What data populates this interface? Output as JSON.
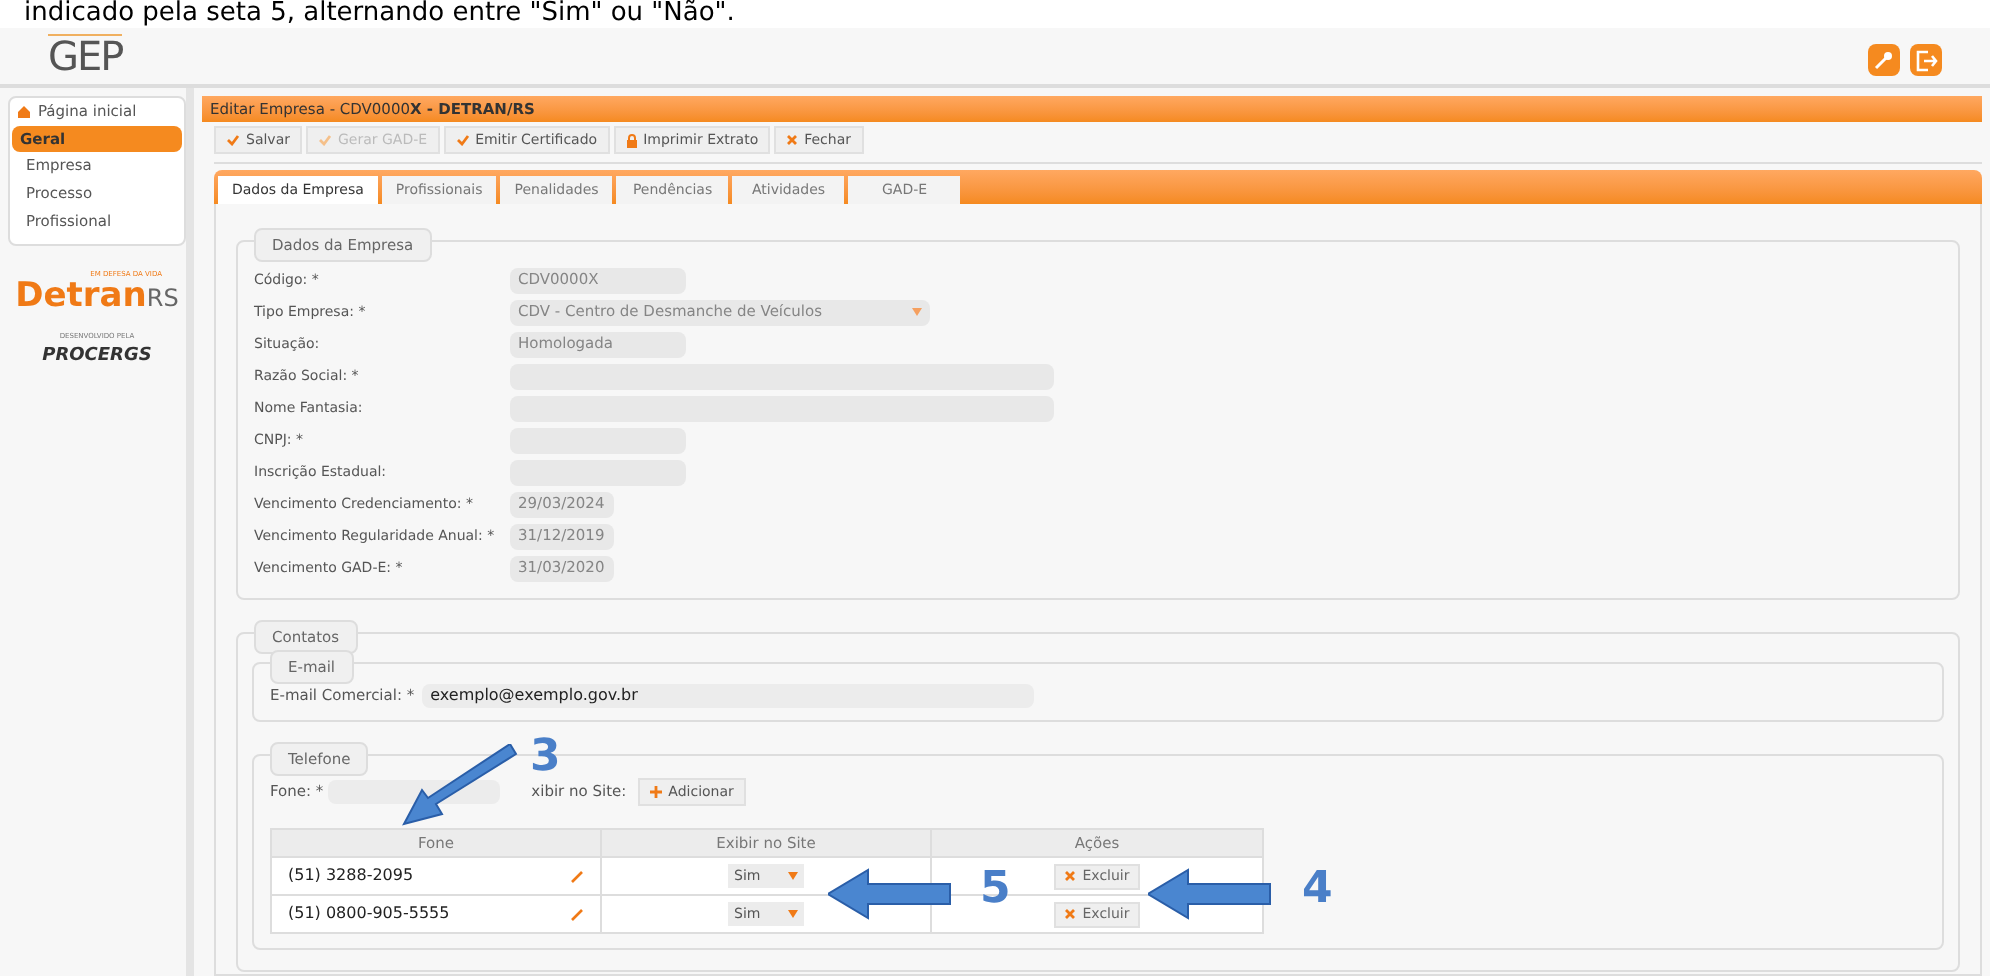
{
  "caption": "indicado pela seta 5, alternando entre \"Sim\" ou \"Não\".",
  "header": {
    "logo": "GEP"
  },
  "sidebar": {
    "home": "Página inicial",
    "section": {
      "label": "Geral",
      "selected": true
    },
    "items": [
      {
        "label": "Empresa",
        "selected": false
      },
      {
        "label": "Processo",
        "selected": false
      },
      {
        "label": "Profissional",
        "selected": false
      }
    ],
    "brand": {
      "tagline": "EM DEFESA DA VIDA",
      "name": "Detran",
      "suffix": "RS",
      "credit": "DESENVOLVIDO PELA",
      "maker": "PROCERGS"
    }
  },
  "title": "Editar Empresa - CDV0000**X - DETRAN/RS**",
  "toolbar": [
    {
      "label": "Salvar",
      "kind": "confirm",
      "disabled": false
    },
    {
      "label": "Gerar GAD-E",
      "kind": "confirm",
      "disabled": true
    },
    {
      "label": "Emitir Certificado",
      "kind": "confirm",
      "disabled": false
    },
    {
      "label": "Imprimir Extrato",
      "kind": "print",
      "disabled": false
    },
    {
      "label": "Fechar",
      "kind": "close",
      "disabled": false
    }
  ],
  "tabs": [
    {
      "label": "Dados da Empresa",
      "selected": true
    },
    {
      "label": "Profissionais",
      "selected": false
    },
    {
      "label": "Penalidades",
      "selected": false
    },
    {
      "label": "Pendências",
      "selected": false
    },
    {
      "label": "Atividades",
      "selected": false
    },
    {
      "label": "GAD-E",
      "selected": false
    }
  ],
  "company": {
    "legend": "Dados da Empresa",
    "fields": [
      {
        "label": "Código: *",
        "value": "CDV0000X",
        "kind": "short"
      },
      {
        "label": "Tipo Empresa: *",
        "value": "CDV - Centro de Desmanche de Veículos",
        "kind": "select"
      },
      {
        "label": "Situação:",
        "value": "Homologada",
        "kind": "short"
      },
      {
        "label": "Razão Social: *",
        "kind": "wide"
      },
      {
        "label": "Nome Fantasia:",
        "kind": "wide"
      },
      {
        "label": "CNPJ: *",
        "kind": "short"
      },
      {
        "label": "Inscrição Estadual:",
        "kind": "short"
      },
      {
        "label": "Vencimento Credenciamento: *",
        "value": "29/03/2024",
        "kind": "date"
      },
      {
        "label": "Vencimento Regularidade Anual: *",
        "value": "31/12/2019",
        "kind": "date"
      },
      {
        "label": "Vencimento GAD-E: *",
        "value": "31/03/2020",
        "kind": "date"
      }
    ]
  },
  "contacts": {
    "legend": "Contatos",
    "email": {
      "legend": "E-mail",
      "label": "E-mail Comercial: *",
      "value": "exemplo@exemplo.gov.br"
    },
    "phone": {
      "legend": "Telefone",
      "label": "Fone: *",
      "show_label": "xibir no Site:",
      "add": "Adicionar",
      "columns": [
        "Fone",
        "Exibir no Site",
        "Ações"
      ],
      "rows": [
        {
          "fone": "(51) 3288-2095",
          "show": "Sim",
          "action": "Excluir"
        },
        {
          "fone": "(51) 0800-905-5555",
          "show": "Sim",
          "action": "Excluir"
        }
      ]
    }
  },
  "annotations": [
    "3",
    "5",
    "4"
  ]
}
